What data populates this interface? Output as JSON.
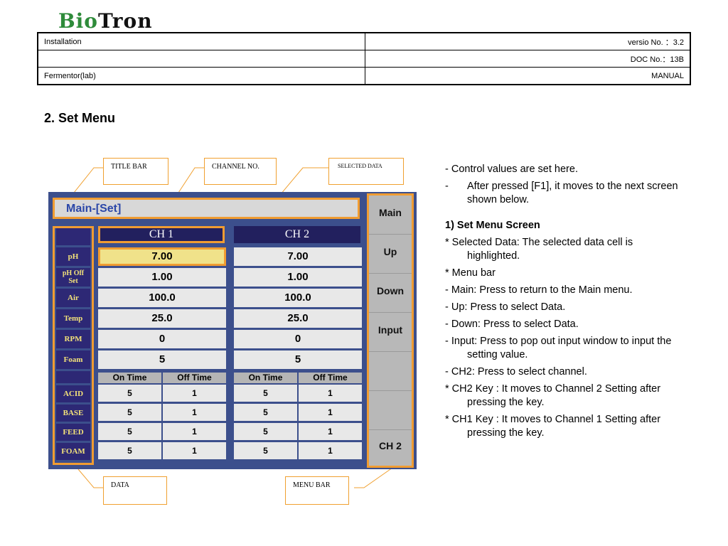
{
  "logo": {
    "part1": "Bio",
    "part2": "Tron"
  },
  "header": {
    "row1_left": "Installation",
    "row1_right": "versio No. ：3.2",
    "row2_left": "",
    "row2_right": "DOC No.：13B",
    "row3_left": "Fermentor(lab)",
    "row3_right": "MANUAL"
  },
  "section_title": "2. Set Menu",
  "callouts": {
    "title_bar": "TITLE BAR",
    "channel_no": "CHANNEL NO.",
    "selected_data": "SELECTED DATA",
    "data": "DATA",
    "menu_bar": "MENU BAR"
  },
  "screen": {
    "title": "Main-[Set]",
    "row_labels": [
      "pH",
      "pH Off Set",
      "Air",
      "Temp",
      "RPM",
      "Foam",
      "ACID",
      "BASE",
      "FEED",
      "FOAM"
    ],
    "channels": [
      {
        "name": "CH 1",
        "values": [
          "7.00",
          "1.00",
          "100.0",
          "25.0",
          "0",
          "5"
        ],
        "on_header": "On Time",
        "off_header": "Off Time",
        "timers": [
          [
            "5",
            "1"
          ],
          [
            "5",
            "1"
          ],
          [
            "5",
            "1"
          ],
          [
            "5",
            "1"
          ]
        ]
      },
      {
        "name": "CH 2",
        "values": [
          "7.00",
          "1.00",
          "100.0",
          "25.0",
          "0",
          "5"
        ],
        "on_header": "On Time",
        "off_header": "Off Time",
        "timers": [
          [
            "5",
            "1"
          ],
          [
            "5",
            "1"
          ],
          [
            "5",
            "1"
          ],
          [
            "5",
            "1"
          ]
        ]
      }
    ],
    "menu": [
      "Main",
      "Up",
      "Down",
      "Input",
      "",
      "",
      "CH 2"
    ]
  },
  "notes": {
    "l1": "- Control values are set here.",
    "l2_dash": "-",
    "l2": "After pressed [F1], it moves to the next screen shown below.",
    "h1": "1) Set Menu Screen",
    "l3": "* Selected Data: The selected data cell is highlighted.",
    "l4": "* Menu bar",
    "l5": "- Main: Press to return to the Main menu.",
    "l6": "- Up: Press to select Data.",
    "l7": "- Down: Press to select Data.",
    "l8": "- Input: Press to pop out input window to input the setting value.",
    "l9": "- CH2: Press to select channel.",
    "l10": "* CH2 Key : It moves to Channel 2 Setting after pressing the key.",
    "l11": "* CH1 Key : It moves to Channel 1 Setting after pressing the key."
  },
  "colors": {
    "accent": "#f09c32",
    "panel": "#3c4f8c",
    "label_bg": "#2d2875",
    "label_text": "#f3e27a",
    "selected": "#f0e28a"
  }
}
